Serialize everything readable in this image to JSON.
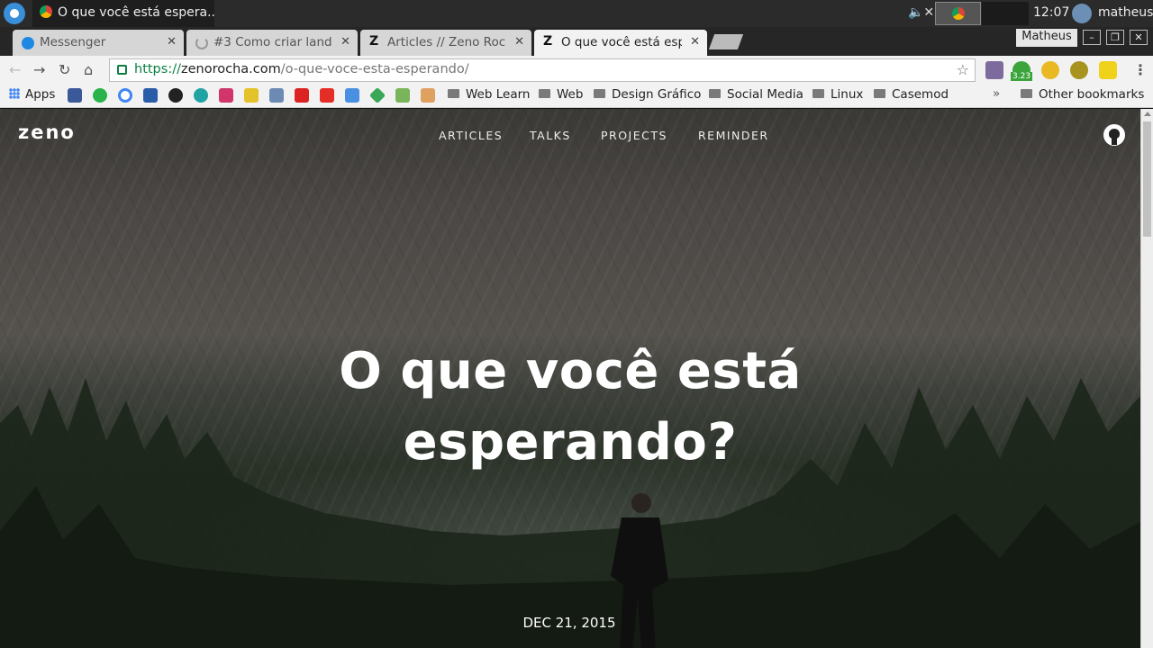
{
  "taskbar": {
    "active_window": "O que você está espera...",
    "clock": "12:07",
    "user": "matheus"
  },
  "tabs": [
    {
      "label": "Messenger",
      "icon": "messenger-icon"
    },
    {
      "label": "#3 Como criar landi",
      "icon": "loading-icon"
    },
    {
      "label": "Articles // Zeno Roch",
      "icon": "zeno-z-icon"
    },
    {
      "label": "O que você está esp",
      "icon": "zeno-z-icon"
    }
  ],
  "profile": "Matheus",
  "omnibox": {
    "scheme": "https://",
    "host": "zenorocha.com",
    "path": "/o-que-voce-esta-esperando/"
  },
  "extension_badge": "3.23",
  "bookmarks": {
    "apps": "Apps",
    "folders": [
      "Web Learn",
      "Web",
      "Design Gráfico",
      "Social Media",
      "Linux",
      "Casemod"
    ],
    "other": "Other bookmarks"
  },
  "site": {
    "logo": "zeno",
    "nav": [
      "ARTICLES",
      "TALKS",
      "PROJECTS",
      "REMINDER"
    ],
    "title_line1": "O que você está",
    "title_line2": "esperando?",
    "date": "DEC 21, 2015"
  },
  "colors": {
    "secure_green": "#0b8043",
    "hero_text": "#ffffff",
    "tab_strip": "#262626"
  }
}
